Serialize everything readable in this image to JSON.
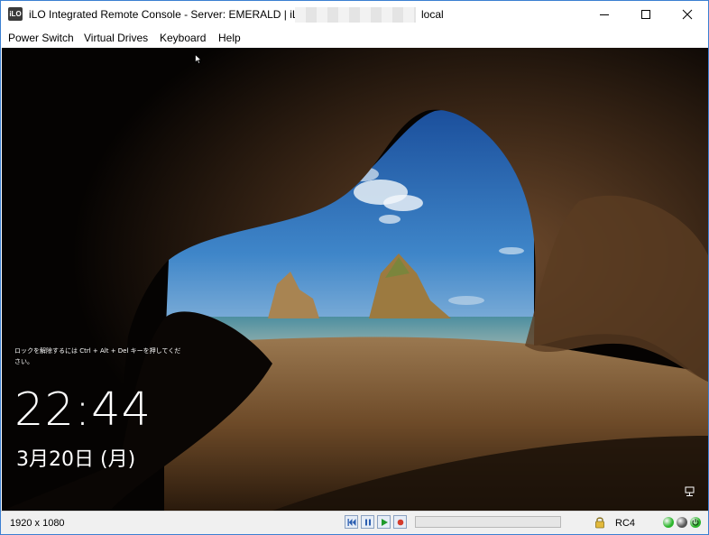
{
  "window": {
    "title": "iLO Integrated Remote Console - Server: EMERALD | iLO:",
    "title_host_suffix": "local",
    "logo_text": "iLO"
  },
  "menu": {
    "items": [
      "Power Switch",
      "Virtual Drives",
      "Keyboard",
      "Help"
    ]
  },
  "remote_screen": {
    "lock_message": "ロックを解除するには Ctrl + Alt + Del キーを押してください。",
    "time": "22:44",
    "date": "3月20日 (月)"
  },
  "status_bar": {
    "resolution": "1920 x 1080",
    "playback_buttons": [
      "rewind-icon",
      "pause-icon",
      "play-icon",
      "record-icon"
    ],
    "progress": 0,
    "cipher": "RC4",
    "indicators": [
      {
        "name": "status-led-green",
        "color": "#2bb52b"
      },
      {
        "name": "status-led-gray",
        "color": "#555555"
      },
      {
        "name": "power-led-green",
        "color": "#2bb52b"
      }
    ]
  },
  "colors": {
    "accent_border": "#3b7fd1",
    "progress_fill": "#06b025"
  }
}
